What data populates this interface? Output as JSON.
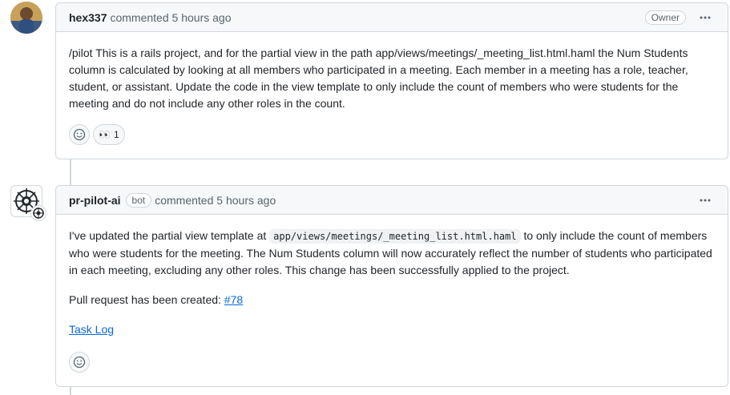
{
  "comments": [
    {
      "author": "hex337",
      "action": "commented",
      "time": "5 hours ago",
      "role_label": "Owner",
      "body": "/pilot This is a rails project, and for the partial view in the path app/views/meetings/_meeting_list.html.haml the Num Students column is calculated by looking at all members who participated in a meeting. Each member in a meeting has a role, teacher, student, or assistant. Update the code in the view template to only include the count of members who were students for the meeting and do not include any other roles in the count.",
      "reactions": [
        {
          "emoji": "👀",
          "count": "1"
        }
      ]
    },
    {
      "author": "pr-pilot-ai",
      "bot_label": "bot",
      "action": "commented",
      "time": "5 hours ago",
      "body_before_code": "I've updated the partial view template at",
      "body_code": "app/views/meetings/_meeting_list.html.haml",
      "body_after_code": "to only include the count of members who were students for the meeting. The Num Students column will now accurately reflect the number of students who participated in each meeting, excluding any other roles. This change has been successfully applied to the project.",
      "pr_text": "Pull request has been created:",
      "pr_link": "#78",
      "task_log": "Task Log"
    }
  ],
  "icons": {
    "more": "kebab-horizontal-icon",
    "add_reaction": "smiley-icon"
  }
}
